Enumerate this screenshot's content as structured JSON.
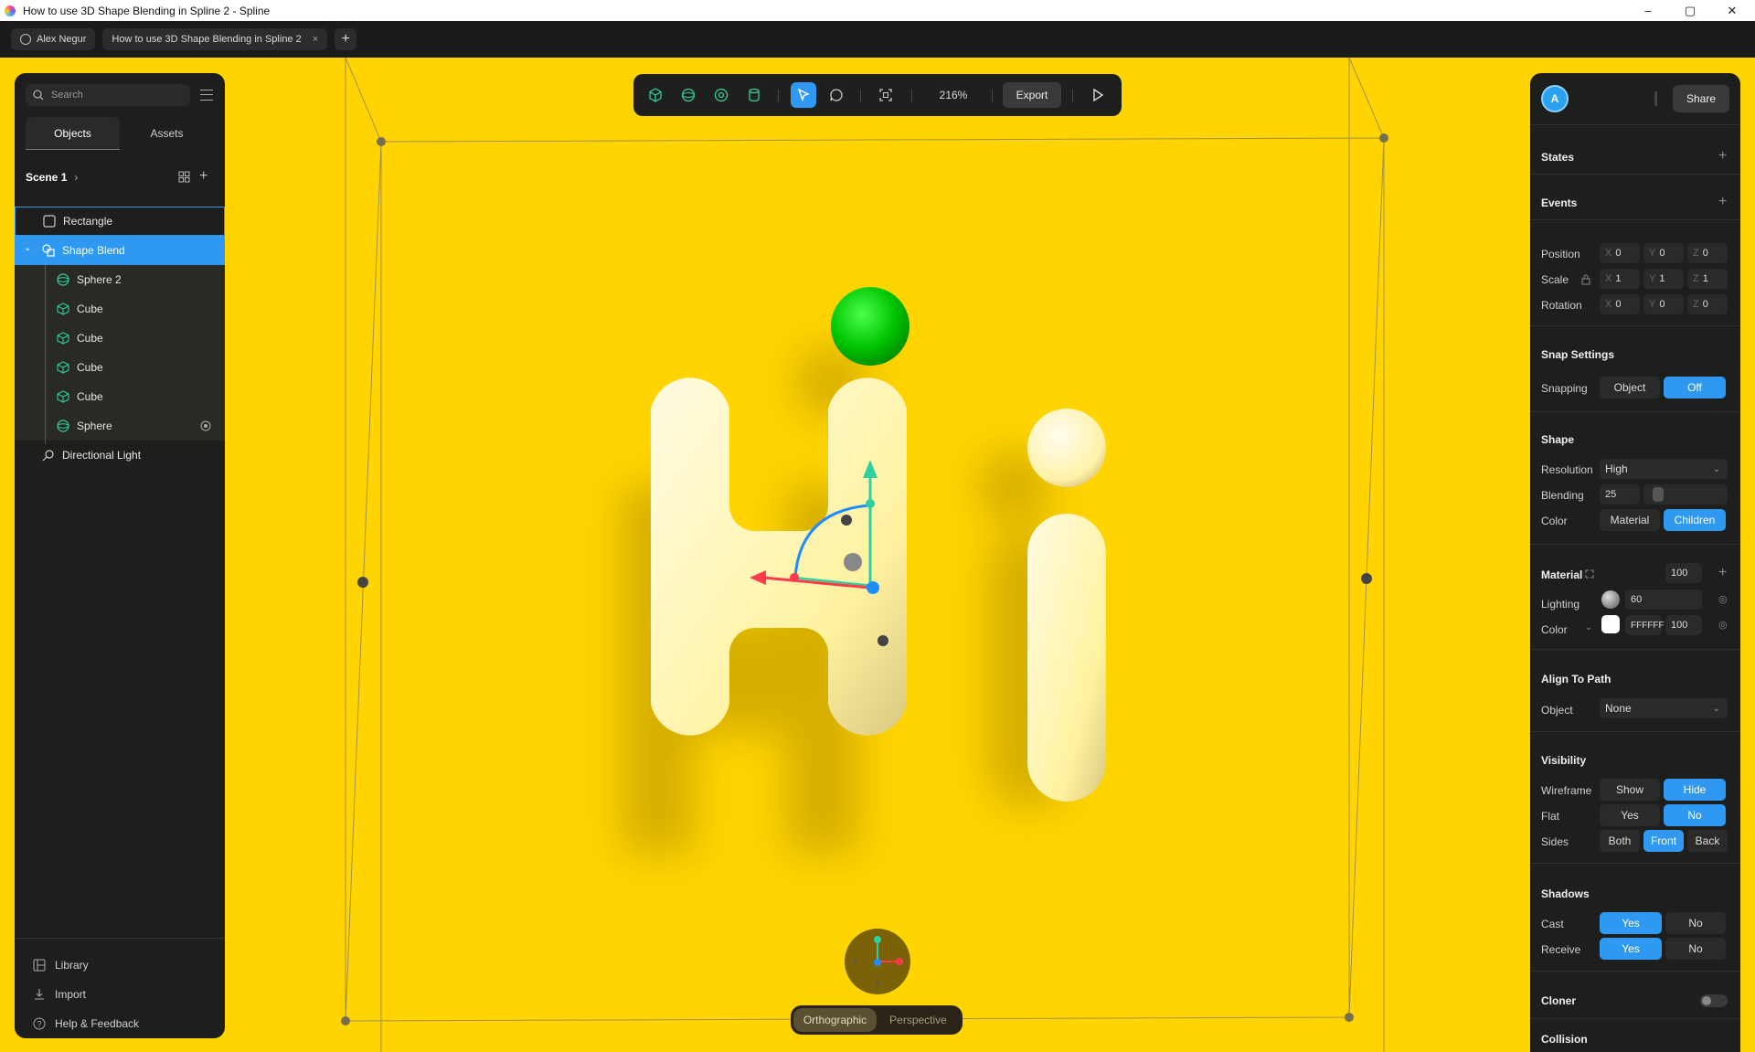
{
  "window": {
    "title": "How to use 3D Shape Blending in Spline 2 - Spline",
    "controls": [
      "–",
      "▢",
      "✕"
    ]
  },
  "tabbar": {
    "user_tab": "Alex Negur",
    "doc_tab": "How to use 3D Shape Blending in Spline 2",
    "close": "×",
    "add": "+"
  },
  "left_panel": {
    "search_placeholder": "Search",
    "tabs": [
      "Objects",
      "Assets"
    ],
    "scene_label": "Scene 1",
    "tree": [
      {
        "label": "Rectangle",
        "icon": "rectangle-icon"
      },
      {
        "label": "Shape Blend",
        "icon": "shape-blend-icon"
      },
      {
        "label": "Sphere 2",
        "icon": "sphere-icon"
      },
      {
        "label": "Cube",
        "icon": "cube-icon"
      },
      {
        "label": "Cube",
        "icon": "cube-icon"
      },
      {
        "label": "Cube",
        "icon": "cube-icon"
      },
      {
        "label": "Cube",
        "icon": "cube-icon"
      },
      {
        "label": "Sphere",
        "icon": "sphere-icon"
      },
      {
        "label": "Directional Light",
        "icon": "light-icon"
      }
    ],
    "bottom_links": [
      "Library",
      "Import",
      "Help & Feedback"
    ]
  },
  "toolbar": {
    "zoom": "216%",
    "export": "Export"
  },
  "view_toggle": {
    "orthographic": "Orthographic",
    "perspective": "Perspective",
    "active": "Orthographic"
  },
  "right_panel": {
    "avatar_letter": "A",
    "share": "Share",
    "states": "States",
    "events": "Events",
    "transform": {
      "position_label": "Position",
      "scale_label": "Scale",
      "rotation_label": "Rotation",
      "axes": [
        "X",
        "Y",
        "Z"
      ],
      "position": [
        "0",
        "0",
        "0"
      ],
      "scale": [
        "1",
        "1",
        "1"
      ],
      "rotation": [
        "0",
        "0",
        "0"
      ]
    },
    "snap": {
      "title": "Snap Settings",
      "label": "Snapping",
      "options": [
        "Object",
        "Off"
      ],
      "active": "Off"
    },
    "shape": {
      "title": "Shape",
      "resolution_label": "Resolution",
      "resolution": "High",
      "blending_label": "Blending",
      "blending": "25",
      "color_label": "Color",
      "color_options": [
        "Material",
        "Children"
      ],
      "color_active": "Children"
    },
    "material": {
      "title": "Material",
      "opacity": "100",
      "lighting_label": "Lighting",
      "lighting": "60",
      "color_label": "Color",
      "color_hex": "FFFFFF",
      "color_opacity": "100"
    },
    "align": {
      "title": "Align To Path",
      "object_label": "Object",
      "object": "None"
    },
    "visibility": {
      "title": "Visibility",
      "wireframe_label": "Wireframe",
      "wireframe_options": [
        "Show",
        "Hide"
      ],
      "wireframe_active": "Hide",
      "flat_label": "Flat",
      "flat_options": [
        "Yes",
        "No"
      ],
      "flat_active": "No",
      "sides_label": "Sides",
      "sides_options": [
        "Both",
        "Front",
        "Back"
      ],
      "sides_active": "Front"
    },
    "shadows": {
      "title": "Shadows",
      "cast_label": "Cast",
      "cast_options": [
        "Yes",
        "No"
      ],
      "cast_active": "Yes",
      "receive_label": "Receive",
      "receive_options": [
        "Yes",
        "No"
      ],
      "receive_active": "Yes"
    },
    "cloner": "Cloner",
    "collision": "Collision"
  },
  "colors": {
    "background": "#ffd400",
    "accent": "#2f98f0",
    "sphere_green": "#00c800",
    "shape_cream": "#fff4b0"
  }
}
